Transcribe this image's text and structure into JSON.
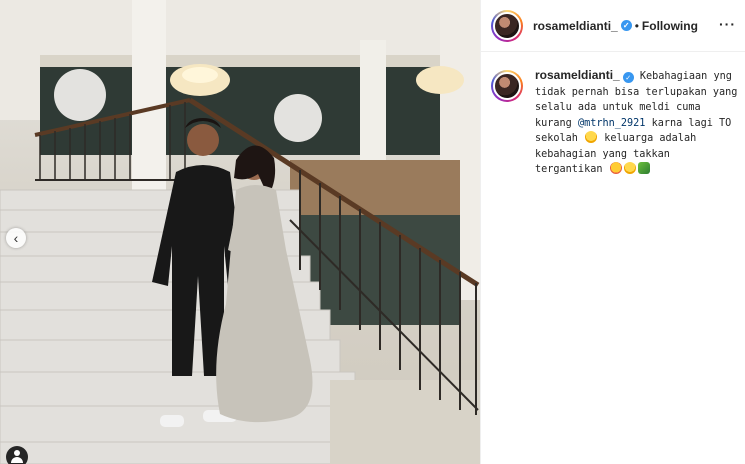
{
  "post": {
    "username": "rosameldianti_",
    "verified_mark": "✓",
    "separator": "•",
    "follow_status": "Following",
    "more_label": "···"
  },
  "caption": {
    "username": "rosameldianti_",
    "text_1": "Kebahagiaan yng tidak pernah bisa terlupakan yang selalu ada untuk meldi cuma kurang",
    "mention": "@mtrhn_2921",
    "text_2": "karna lagi TO sekolah",
    "text_3": "keluarga adalah kebahagian yang takkan tergantikan"
  },
  "photo": {
    "prev_arrow": "‹"
  },
  "colors": {
    "verified": "#3897f0",
    "mention": "#003569",
    "border": "#efefef"
  },
  "icons": [
    "verified-badge-icon",
    "more-options-icon",
    "chevron-left-icon",
    "user-tag-icon",
    "hugging-emoji-icon",
    "hearts-emoji-icon",
    "snake-emoji-icon"
  ]
}
